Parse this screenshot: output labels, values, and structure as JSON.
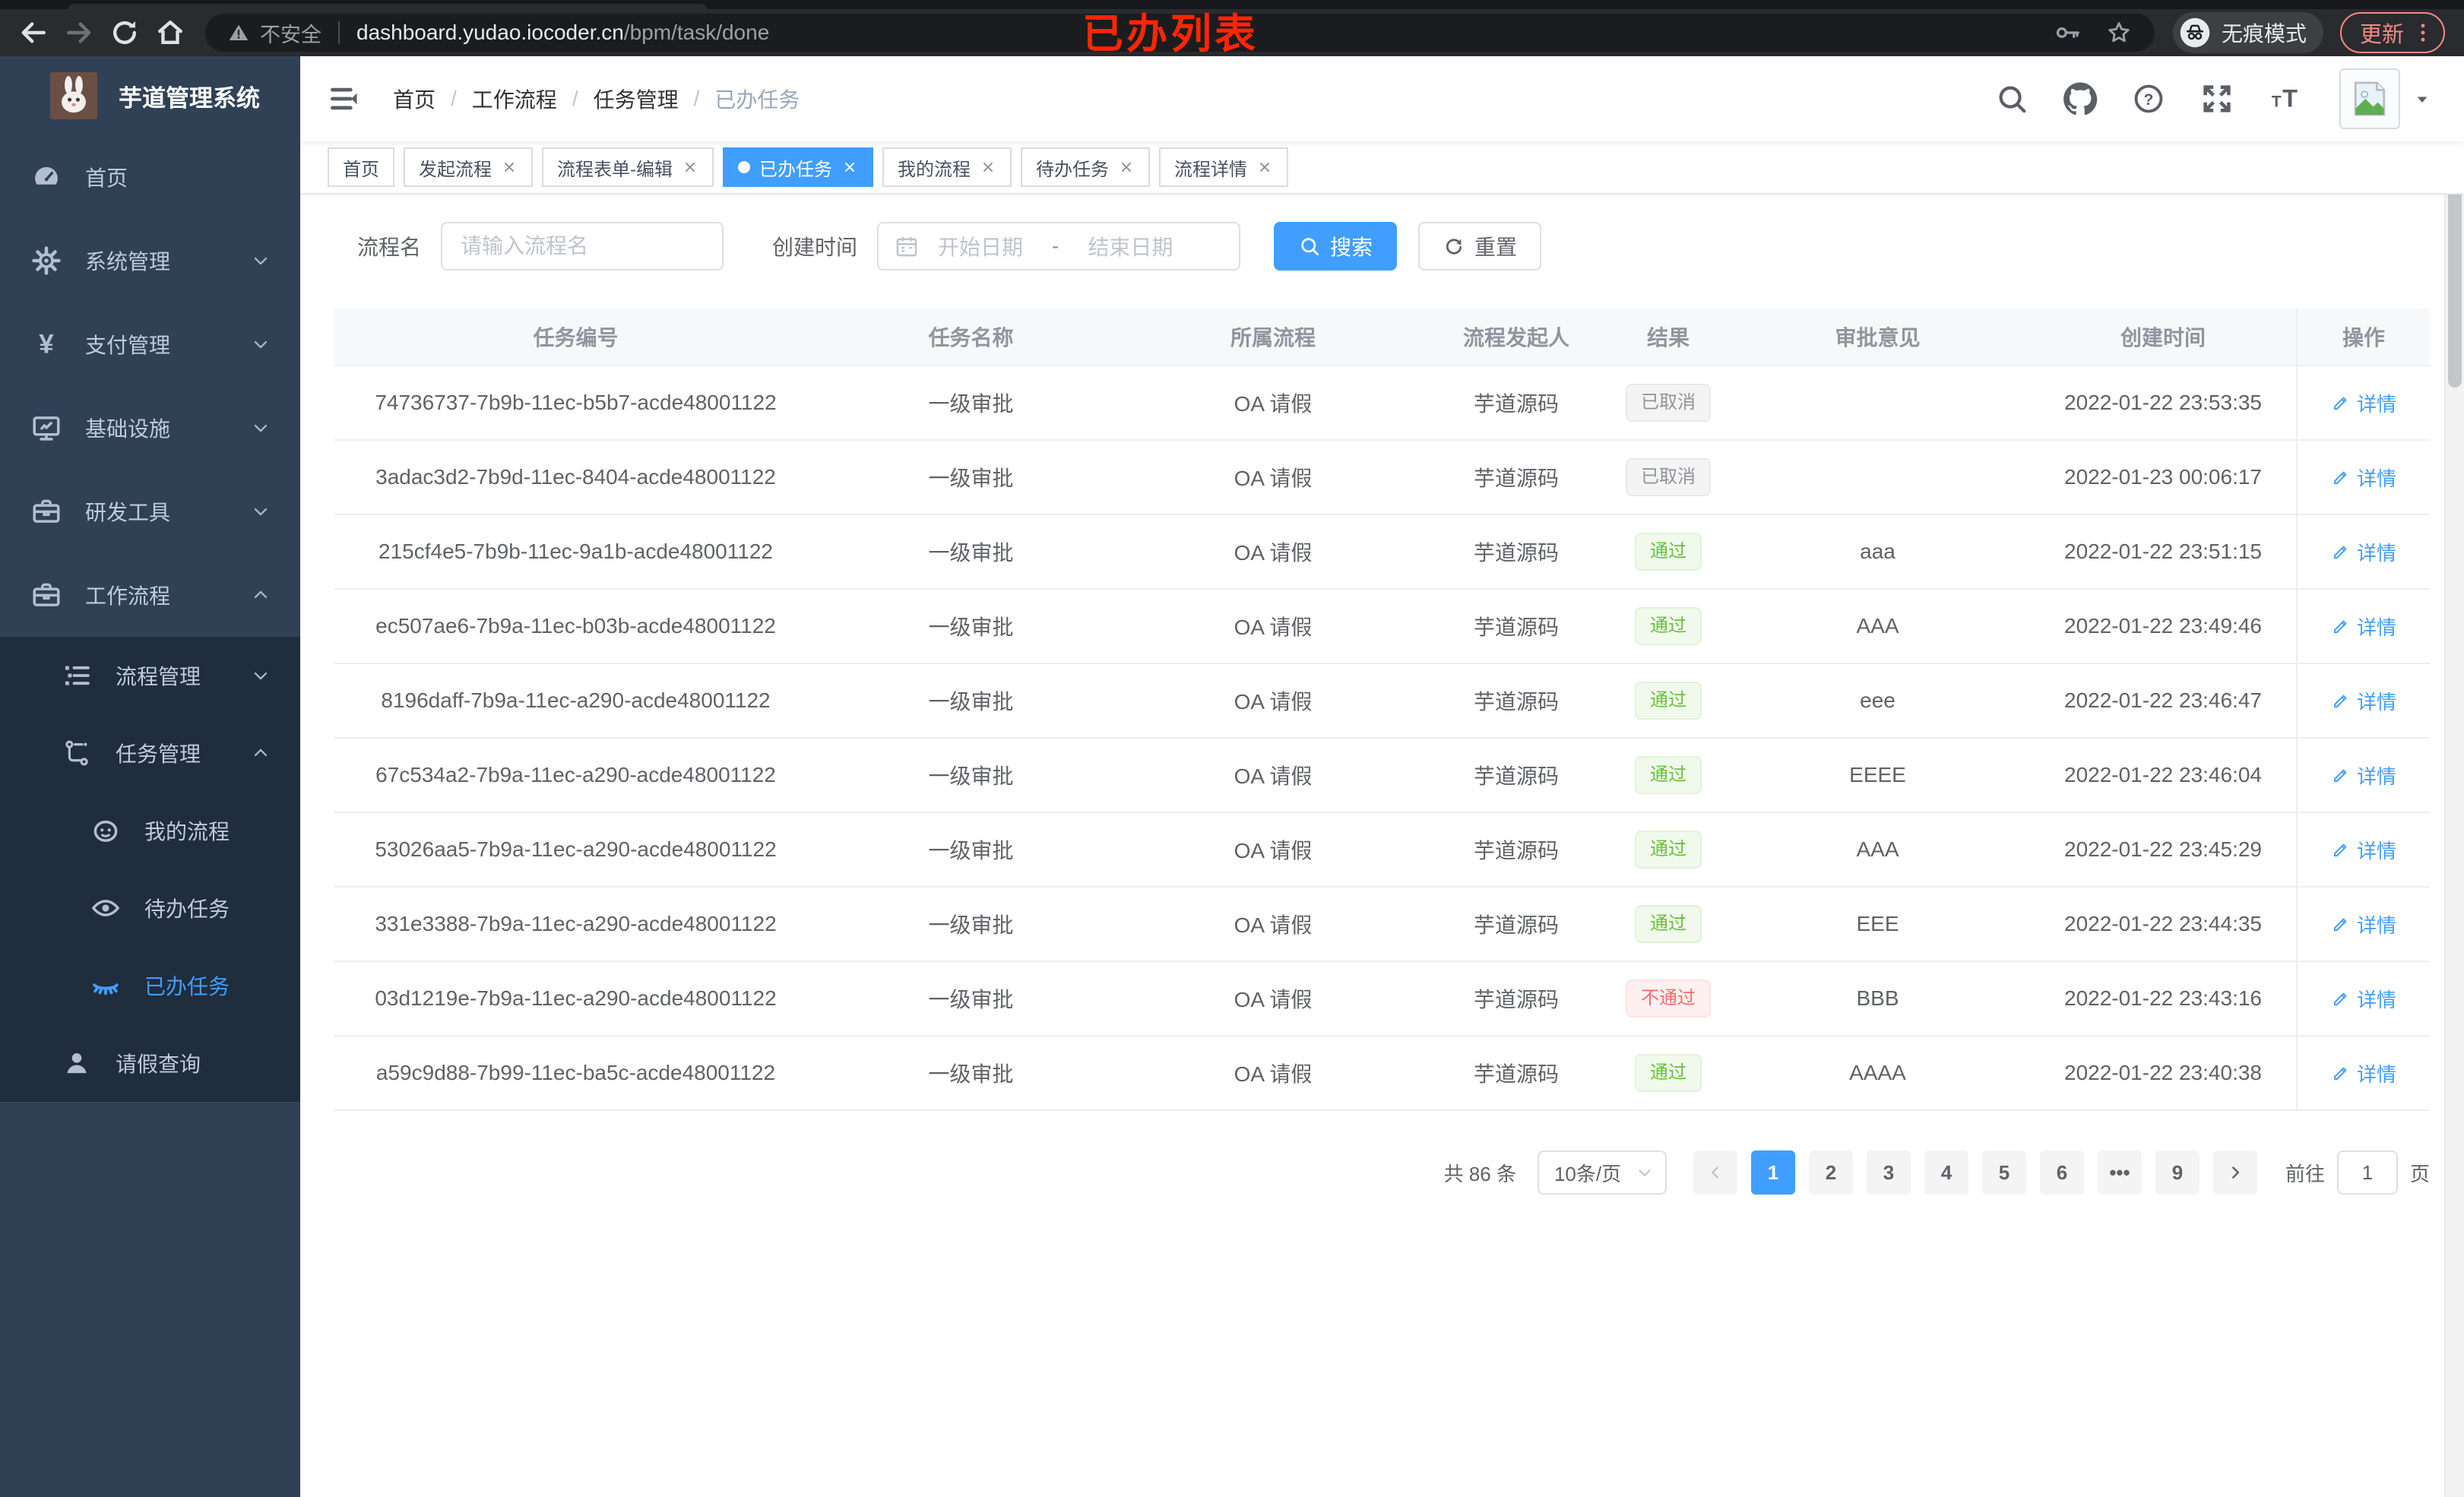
{
  "colors": {
    "accent": "#409eff",
    "success": "#67c23a",
    "danger": "#f56c6c",
    "info": "#909399",
    "annotation_red": "#ff2600",
    "update_button_salmon": "#f28b82",
    "sidebar_bg": "#304156",
    "submenu_bg": "#1f2d3d"
  },
  "browser": {
    "nav_icons": [
      "back-icon",
      "forward-icon",
      "reload-icon",
      "home-icon"
    ],
    "security_label": "不安全",
    "url_host": "dashboard.yudao.iocoder.cn",
    "url_path": "/bpm/task/done",
    "trailing_icons": [
      "key-icon",
      "star-icon"
    ],
    "incognito_label": "无痕模式",
    "update_label": "更新",
    "annotation": "已办列表"
  },
  "sidebar": {
    "app_title": "芋道管理系统",
    "logo_icon": "rabbit-logo",
    "items": [
      {
        "label": "首页",
        "icon": "dashboard-icon",
        "level": 1
      },
      {
        "label": "系统管理",
        "icon": "gear-icon",
        "level": 1,
        "chevron": "down"
      },
      {
        "label": "支付管理",
        "icon": "yen-icon",
        "level": 1,
        "chevron": "down"
      },
      {
        "label": "基础设施",
        "icon": "monitor-icon",
        "level": 1,
        "chevron": "down"
      },
      {
        "label": "研发工具",
        "icon": "toolbox-icon",
        "level": 1,
        "chevron": "down"
      },
      {
        "label": "工作流程",
        "icon": "briefcase-icon",
        "level": 1,
        "chevron": "up"
      },
      {
        "label": "流程管理",
        "icon": "tree-list-icon",
        "level": 2,
        "chevron": "down"
      },
      {
        "label": "任务管理",
        "icon": "flow-icon",
        "level": 2,
        "chevron": "up"
      },
      {
        "label": "我的流程",
        "icon": "face-icon",
        "level": 3
      },
      {
        "label": "待办任务",
        "icon": "eye-open-icon",
        "level": 3
      },
      {
        "label": "已办任务",
        "icon": "eye-closed-icon",
        "level": 3,
        "active": true
      },
      {
        "label": "请假查询",
        "icon": "user-icon",
        "level": 2
      }
    ]
  },
  "header": {
    "breadcrumb": [
      "首页",
      "工作流程",
      "任务管理",
      "已办任务"
    ],
    "breadcrumb_separator": "/",
    "action_icons": [
      "search-icon",
      "github-icon",
      "help-icon",
      "fullscreen-icon",
      "font-size-icon"
    ]
  },
  "tabs": [
    {
      "label": "首页",
      "closable": false,
      "active": false
    },
    {
      "label": "发起流程",
      "closable": true,
      "active": false
    },
    {
      "label": "流程表单-编辑",
      "closable": true,
      "active": false
    },
    {
      "label": "已办任务",
      "closable": true,
      "active": true
    },
    {
      "label": "我的流程",
      "closable": true,
      "active": false
    },
    {
      "label": "待办任务",
      "closable": true,
      "active": false
    },
    {
      "label": "流程详情",
      "closable": true,
      "active": false
    }
  ],
  "filters": {
    "name_label": "流程名",
    "name_placeholder": "请输入流程名",
    "time_label": "创建时间",
    "start_placeholder": "开始日期",
    "range_separator": "-",
    "end_placeholder": "结束日期",
    "search_label": "搜索",
    "reset_label": "重置"
  },
  "table": {
    "columns": [
      "任务编号",
      "任务名称",
      "所属流程",
      "流程发起人",
      "结果",
      "审批意见",
      "创建时间",
      "操作"
    ],
    "action_label": "详情",
    "rows": [
      {
        "id": "74736737-7b9b-11ec-b5b7-acde48001122",
        "name": "一级审批",
        "process": "OA 请假",
        "starter": "芋道源码",
        "result": {
          "label": "已取消",
          "type": "info"
        },
        "opinion": "",
        "created": "2022-01-22 23:53:35"
      },
      {
        "id": "3adac3d2-7b9d-11ec-8404-acde48001122",
        "name": "一级审批",
        "process": "OA 请假",
        "starter": "芋道源码",
        "result": {
          "label": "已取消",
          "type": "info"
        },
        "opinion": "",
        "created": "2022-01-23 00:06:17"
      },
      {
        "id": "215cf4e5-7b9b-11ec-9a1b-acde48001122",
        "name": "一级审批",
        "process": "OA 请假",
        "starter": "芋道源码",
        "result": {
          "label": "通过",
          "type": "success"
        },
        "opinion": "aaa",
        "created": "2022-01-22 23:51:15"
      },
      {
        "id": "ec507ae6-7b9a-11ec-b03b-acde48001122",
        "name": "一级审批",
        "process": "OA 请假",
        "starter": "芋道源码",
        "result": {
          "label": "通过",
          "type": "success"
        },
        "opinion": "AAA",
        "created": "2022-01-22 23:49:46"
      },
      {
        "id": "8196daff-7b9a-11ec-a290-acde48001122",
        "name": "一级审批",
        "process": "OA 请假",
        "starter": "芋道源码",
        "result": {
          "label": "通过",
          "type": "success"
        },
        "opinion": "eee",
        "created": "2022-01-22 23:46:47"
      },
      {
        "id": "67c534a2-7b9a-11ec-a290-acde48001122",
        "name": "一级审批",
        "process": "OA 请假",
        "starter": "芋道源码",
        "result": {
          "label": "通过",
          "type": "success"
        },
        "opinion": "EEEE",
        "created": "2022-01-22 23:46:04"
      },
      {
        "id": "53026aa5-7b9a-11ec-a290-acde48001122",
        "name": "一级审批",
        "process": "OA 请假",
        "starter": "芋道源码",
        "result": {
          "label": "通过",
          "type": "success"
        },
        "opinion": "AAA",
        "created": "2022-01-22 23:45:29"
      },
      {
        "id": "331e3388-7b9a-11ec-a290-acde48001122",
        "name": "一级审批",
        "process": "OA 请假",
        "starter": "芋道源码",
        "result": {
          "label": "通过",
          "type": "success"
        },
        "opinion": "EEE",
        "created": "2022-01-22 23:44:35"
      },
      {
        "id": "03d1219e-7b9a-11ec-a290-acde48001122",
        "name": "一级审批",
        "process": "OA 请假",
        "starter": "芋道源码",
        "result": {
          "label": "不通过",
          "type": "danger"
        },
        "opinion": "BBB",
        "created": "2022-01-22 23:43:16"
      },
      {
        "id": "a59c9d88-7b99-11ec-ba5c-acde48001122",
        "name": "一级审批",
        "process": "OA 请假",
        "starter": "芋道源码",
        "result": {
          "label": "通过",
          "type": "success"
        },
        "opinion": "AAAA",
        "created": "2022-01-22 23:40:38"
      }
    ]
  },
  "pagination": {
    "total_text": "共 86 条",
    "page_size": "10条/页",
    "pages": [
      "1",
      "2",
      "3",
      "4",
      "5",
      "6",
      "•••",
      "9"
    ],
    "active_page": "1",
    "goto_label": "前往",
    "goto_value": "1",
    "page_unit": "页"
  }
}
